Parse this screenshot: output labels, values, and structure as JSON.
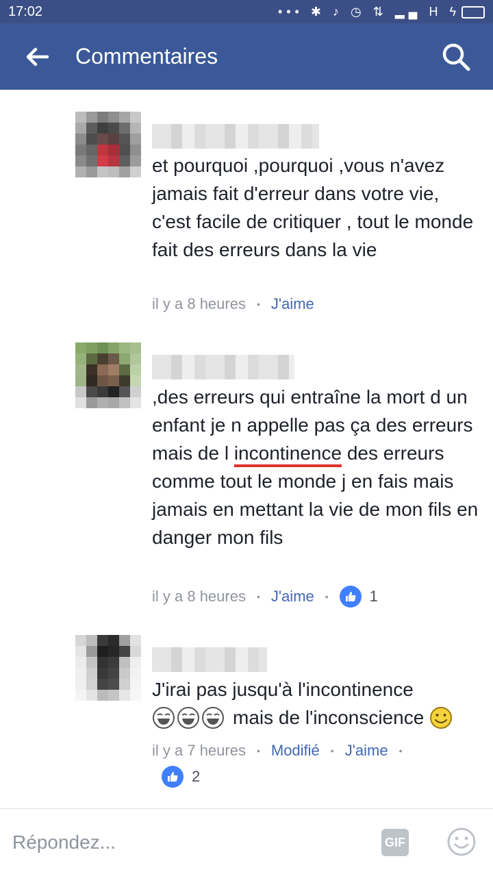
{
  "status_bar": {
    "time": "17:02",
    "network": "H"
  },
  "header": {
    "title": "Commentaires"
  },
  "comments": [
    {
      "text": "et pourquoi ,pourquoi ,vous n'avez jamais fait d'erreur dans votre vie, c'est facile de critiquer , tout le monde fait des erreurs dans la vie",
      "time": "il y a 8 heures",
      "like_label": "J'aime"
    },
    {
      "text_before": ",des erreurs qui entraîne la mort d un enfant je n appelle pas ça des erreurs mais de l ",
      "text_underlined": "incontinence",
      "text_after": " des erreurs comme tout le monde j en fais mais jamais en mettant la vie de mon fils en danger mon fils",
      "time": "il y a 8 heures",
      "like_label": "J'aime",
      "reactions": "1"
    },
    {
      "text": "J'irai pas jusqu'à l'incontinence",
      "text_line2": "mais de l'inconscience",
      "time": "il y a 7 heures",
      "edited_label": "Modifié",
      "like_label": "J'aime",
      "reactions": "2"
    }
  ],
  "reply": {
    "placeholder": "Répondez...",
    "gif_label": "GIF"
  },
  "colors": {
    "header": "#3b5998",
    "status_bar": "#3b4f86",
    "link": "#4267b2",
    "underline": "#e0312e"
  }
}
